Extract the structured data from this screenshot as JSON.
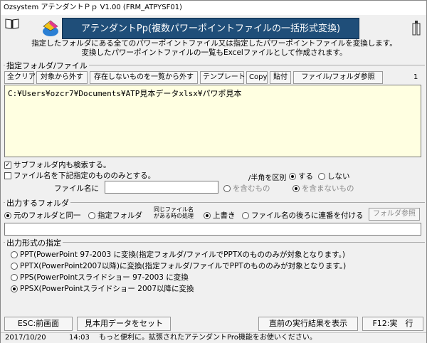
{
  "window": {
    "title": "Ozsystem アテンダントＰｐ V1.00 (FRM_ATPYSF01)"
  },
  "banner": {
    "title": "アテンダントPp(複数パワーポイントファイルの一括形式変換)"
  },
  "description": {
    "line1": "指定したフォルダにある全てのパワーポイントファイル又は指定したパワーポイントファイルを変換します。",
    "line2": "変換したパワーポイントファイルの一覧もExcelファイルとして作成されます。"
  },
  "folder_section": {
    "label": "指定フォルダ/ファイル",
    "buttons": [
      "全クリア",
      "対象から外す",
      "存在しないものを一覧から外す",
      "テンプレート",
      "Copy",
      "貼付",
      "ファイル/フォルダ参照"
    ],
    "count": "1",
    "path": "C:¥Users¥ozcr7¥Documents¥ATP見本データxlsx¥パワポ見本"
  },
  "options": {
    "subfolder": "サブフォルダ内も検索する。",
    "subfolder_checked": true,
    "filename_only": "ファイル名を下記指定のもののみとする。",
    "filename_only_checked": false,
    "case_label": "/半角を区別",
    "case_yes": "する",
    "case_no": "しない",
    "filename_label": "ファイル名に",
    "filename_value": "",
    "contains": "を含むもの",
    "not_contains": "を含まないもの"
  },
  "output_folder": {
    "label": "出力するフォルダ",
    "same": "元のフォルダと同一",
    "specified": "指定フォルダ",
    "samename_line1": "同じファイル名",
    "samename_line2": "がある時の処理",
    "overwrite": "上書き",
    "append_seq": "ファイル名の後ろに連番を付ける",
    "browse": "フォルダ参照",
    "path_value": ""
  },
  "format": {
    "label": "出力形式の指定",
    "options": [
      "PPT(PowerPoint 97-2003 に変換(指定フォルダ/ファイルでPPTXのもののみが対象となります。)",
      "PPTX(PowerPoint2007以降)に変換(指定フォルダ/ファイルでPPTのもののみが対象となります。)",
      "PPS(PowerPointスライドショー 97-2003 に変換",
      "PPSX(PowerPointスライドショー 2007以降に変換"
    ],
    "selected": 3
  },
  "footer": {
    "esc": "ESC:前画面",
    "sample": "見本用データをセット",
    "last_result": "直前の実行結果を表示",
    "run": "F12:実　行"
  },
  "status": {
    "date": "2017/10/20",
    "time": "14:03",
    "message": "もっと便利に。拡張されたアテンダントPro機能をお使いください。"
  }
}
